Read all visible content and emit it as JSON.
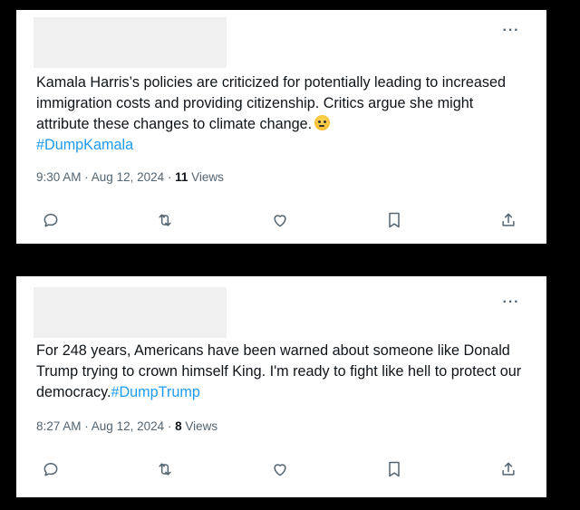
{
  "tweets": [
    {
      "body_text": "Kamala Harris’s policies are criticized for potentially leading to increased immigration costs and providing citizenship. Critics argue she might attribute these changes to climate change.",
      "hashtag": "#DumpKamala",
      "time": "9:30 AM",
      "sep1": " · ",
      "date": "Aug 12, 2024",
      "sep2": " · ",
      "views_count": "11",
      "views_label": " Views",
      "more_label": "···",
      "emoji": "face-with-rolling-eyes"
    },
    {
      "body_text": "For 248 years, Americans have been warned about someone like Donald Trump trying to crown himself King. I'm ready to fight like hell to protect our democracy.",
      "hashtag": "#DumpTrump",
      "time": "8:27 AM",
      "sep1": " · ",
      "date": "Aug 12, 2024",
      "sep2": " · ",
      "views_count": "8",
      "views_label": " Views",
      "more_label": "···"
    }
  ],
  "icons": [
    "reply-icon",
    "retweet-icon",
    "like-icon",
    "bookmark-icon",
    "share-icon"
  ],
  "colors": {
    "hashtag": "#1d9bf0",
    "meta": "#536471",
    "text": "#0f1419"
  }
}
